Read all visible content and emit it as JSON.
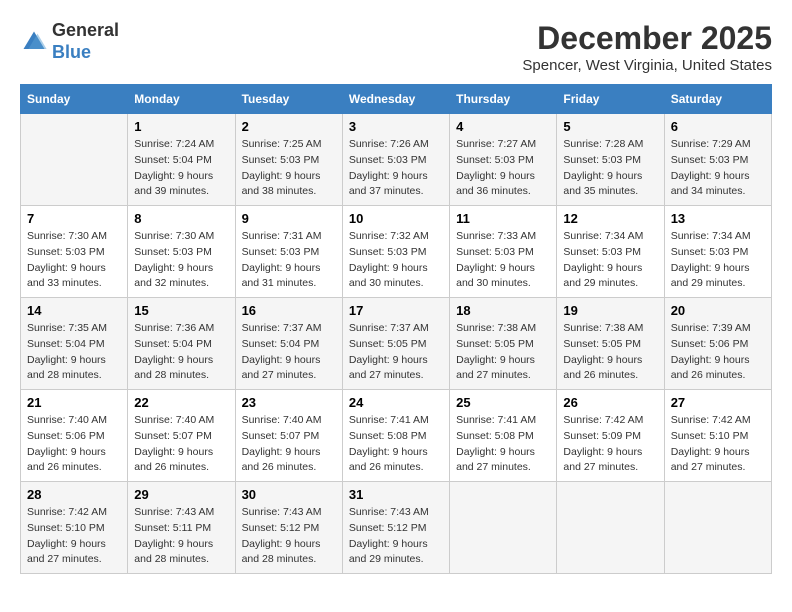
{
  "logo": {
    "general": "General",
    "blue": "Blue"
  },
  "title": {
    "month": "December 2025",
    "location": "Spencer, West Virginia, United States"
  },
  "headers": [
    "Sunday",
    "Monday",
    "Tuesday",
    "Wednesday",
    "Thursday",
    "Friday",
    "Saturday"
  ],
  "weeks": [
    [
      {
        "num": "",
        "sunrise": "",
        "sunset": "",
        "daylight": ""
      },
      {
        "num": "1",
        "sunrise": "Sunrise: 7:24 AM",
        "sunset": "Sunset: 5:04 PM",
        "daylight": "Daylight: 9 hours and 39 minutes."
      },
      {
        "num": "2",
        "sunrise": "Sunrise: 7:25 AM",
        "sunset": "Sunset: 5:03 PM",
        "daylight": "Daylight: 9 hours and 38 minutes."
      },
      {
        "num": "3",
        "sunrise": "Sunrise: 7:26 AM",
        "sunset": "Sunset: 5:03 PM",
        "daylight": "Daylight: 9 hours and 37 minutes."
      },
      {
        "num": "4",
        "sunrise": "Sunrise: 7:27 AM",
        "sunset": "Sunset: 5:03 PM",
        "daylight": "Daylight: 9 hours and 36 minutes."
      },
      {
        "num": "5",
        "sunrise": "Sunrise: 7:28 AM",
        "sunset": "Sunset: 5:03 PM",
        "daylight": "Daylight: 9 hours and 35 minutes."
      },
      {
        "num": "6",
        "sunrise": "Sunrise: 7:29 AM",
        "sunset": "Sunset: 5:03 PM",
        "daylight": "Daylight: 9 hours and 34 minutes."
      }
    ],
    [
      {
        "num": "7",
        "sunrise": "Sunrise: 7:30 AM",
        "sunset": "Sunset: 5:03 PM",
        "daylight": "Daylight: 9 hours and 33 minutes."
      },
      {
        "num": "8",
        "sunrise": "Sunrise: 7:30 AM",
        "sunset": "Sunset: 5:03 PM",
        "daylight": "Daylight: 9 hours and 32 minutes."
      },
      {
        "num": "9",
        "sunrise": "Sunrise: 7:31 AM",
        "sunset": "Sunset: 5:03 PM",
        "daylight": "Daylight: 9 hours and 31 minutes."
      },
      {
        "num": "10",
        "sunrise": "Sunrise: 7:32 AM",
        "sunset": "Sunset: 5:03 PM",
        "daylight": "Daylight: 9 hours and 30 minutes."
      },
      {
        "num": "11",
        "sunrise": "Sunrise: 7:33 AM",
        "sunset": "Sunset: 5:03 PM",
        "daylight": "Daylight: 9 hours and 30 minutes."
      },
      {
        "num": "12",
        "sunrise": "Sunrise: 7:34 AM",
        "sunset": "Sunset: 5:03 PM",
        "daylight": "Daylight: 9 hours and 29 minutes."
      },
      {
        "num": "13",
        "sunrise": "Sunrise: 7:34 AM",
        "sunset": "Sunset: 5:03 PM",
        "daylight": "Daylight: 9 hours and 29 minutes."
      }
    ],
    [
      {
        "num": "14",
        "sunrise": "Sunrise: 7:35 AM",
        "sunset": "Sunset: 5:04 PM",
        "daylight": "Daylight: 9 hours and 28 minutes."
      },
      {
        "num": "15",
        "sunrise": "Sunrise: 7:36 AM",
        "sunset": "Sunset: 5:04 PM",
        "daylight": "Daylight: 9 hours and 28 minutes."
      },
      {
        "num": "16",
        "sunrise": "Sunrise: 7:37 AM",
        "sunset": "Sunset: 5:04 PM",
        "daylight": "Daylight: 9 hours and 27 minutes."
      },
      {
        "num": "17",
        "sunrise": "Sunrise: 7:37 AM",
        "sunset": "Sunset: 5:05 PM",
        "daylight": "Daylight: 9 hours and 27 minutes."
      },
      {
        "num": "18",
        "sunrise": "Sunrise: 7:38 AM",
        "sunset": "Sunset: 5:05 PM",
        "daylight": "Daylight: 9 hours and 27 minutes."
      },
      {
        "num": "19",
        "sunrise": "Sunrise: 7:38 AM",
        "sunset": "Sunset: 5:05 PM",
        "daylight": "Daylight: 9 hours and 26 minutes."
      },
      {
        "num": "20",
        "sunrise": "Sunrise: 7:39 AM",
        "sunset": "Sunset: 5:06 PM",
        "daylight": "Daylight: 9 hours and 26 minutes."
      }
    ],
    [
      {
        "num": "21",
        "sunrise": "Sunrise: 7:40 AM",
        "sunset": "Sunset: 5:06 PM",
        "daylight": "Daylight: 9 hours and 26 minutes."
      },
      {
        "num": "22",
        "sunrise": "Sunrise: 7:40 AM",
        "sunset": "Sunset: 5:07 PM",
        "daylight": "Daylight: 9 hours and 26 minutes."
      },
      {
        "num": "23",
        "sunrise": "Sunrise: 7:40 AM",
        "sunset": "Sunset: 5:07 PM",
        "daylight": "Daylight: 9 hours and 26 minutes."
      },
      {
        "num": "24",
        "sunrise": "Sunrise: 7:41 AM",
        "sunset": "Sunset: 5:08 PM",
        "daylight": "Daylight: 9 hours and 26 minutes."
      },
      {
        "num": "25",
        "sunrise": "Sunrise: 7:41 AM",
        "sunset": "Sunset: 5:08 PM",
        "daylight": "Daylight: 9 hours and 27 minutes."
      },
      {
        "num": "26",
        "sunrise": "Sunrise: 7:42 AM",
        "sunset": "Sunset: 5:09 PM",
        "daylight": "Daylight: 9 hours and 27 minutes."
      },
      {
        "num": "27",
        "sunrise": "Sunrise: 7:42 AM",
        "sunset": "Sunset: 5:10 PM",
        "daylight": "Daylight: 9 hours and 27 minutes."
      }
    ],
    [
      {
        "num": "28",
        "sunrise": "Sunrise: 7:42 AM",
        "sunset": "Sunset: 5:10 PM",
        "daylight": "Daylight: 9 hours and 27 minutes."
      },
      {
        "num": "29",
        "sunrise": "Sunrise: 7:43 AM",
        "sunset": "Sunset: 5:11 PM",
        "daylight": "Daylight: 9 hours and 28 minutes."
      },
      {
        "num": "30",
        "sunrise": "Sunrise: 7:43 AM",
        "sunset": "Sunset: 5:12 PM",
        "daylight": "Daylight: 9 hours and 28 minutes."
      },
      {
        "num": "31",
        "sunrise": "Sunrise: 7:43 AM",
        "sunset": "Sunset: 5:12 PM",
        "daylight": "Daylight: 9 hours and 29 minutes."
      },
      {
        "num": "",
        "sunrise": "",
        "sunset": "",
        "daylight": ""
      },
      {
        "num": "",
        "sunrise": "",
        "sunset": "",
        "daylight": ""
      },
      {
        "num": "",
        "sunrise": "",
        "sunset": "",
        "daylight": ""
      }
    ]
  ]
}
